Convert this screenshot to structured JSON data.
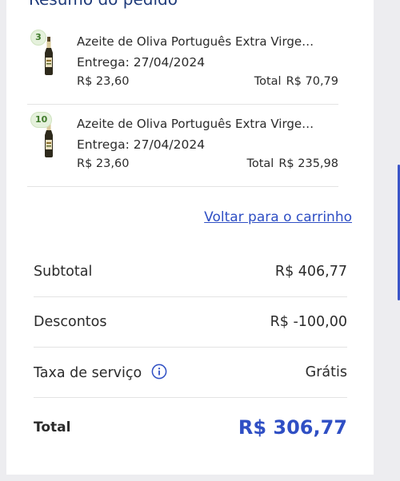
{
  "order_summary": {
    "title": "Resumo do pedido",
    "items": [
      {
        "quantity": "3",
        "name": "Azeite de Oliva Português Extra Virge…",
        "delivery": "Entrega: 27/04/2024",
        "unit_price": "R$ 23,60",
        "total_label": "Total",
        "total_value": "R$ 70,79",
        "icon": "olive-oil-bottle-icon"
      },
      {
        "quantity": "10",
        "name": "Azeite de Oliva Português Extra Virge…",
        "delivery": "Entrega: 27/04/2024",
        "unit_price": "R$ 23,60",
        "total_label": "Total",
        "total_value": "R$ 235,98",
        "icon": "olive-oil-bottle-icon"
      }
    ],
    "back_to_cart": "Voltar para o carrinho"
  },
  "totals": {
    "subtotal_label": "Subtotal",
    "subtotal_value": "R$ 406,77",
    "discounts_label": "Descontos",
    "discounts_value": "R$ -100,00",
    "service_fee_label": "Taxa de serviço",
    "service_fee_value": "Grátis",
    "service_fee_icon": "info-icon",
    "total_label": "Total",
    "total_value": "R$ 306,77"
  },
  "colors": {
    "accent": "#2f4fc4",
    "title": "#1e3a7a",
    "qty_badge_bg": "#e5f1dc",
    "qty_badge_text": "#3f7a2a"
  }
}
